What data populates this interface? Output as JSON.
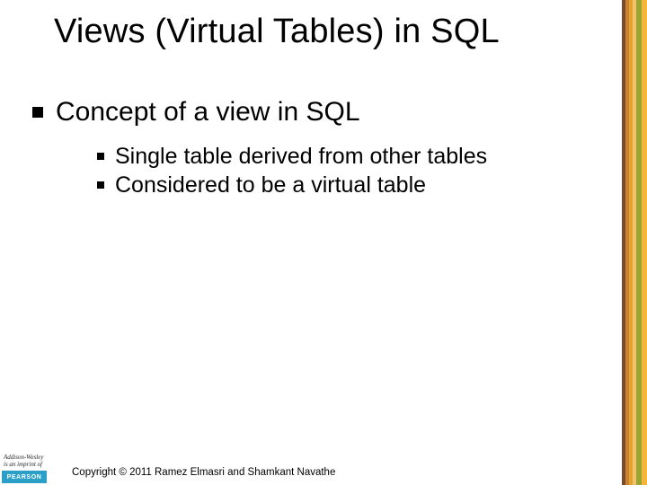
{
  "title": "Views (Virtual Tables) in SQL",
  "level1": {
    "item1": "Concept of a view in SQL"
  },
  "level2": {
    "item1": "Single table derived from other tables",
    "item2": "Considered to be a virtual table"
  },
  "footer": {
    "publisher_line1": "Addison-Wesley",
    "publisher_line2": "is an imprint of",
    "brand": "PEARSON",
    "copyright": "Copyright © 2011 Ramez Elmasri and Shamkant Navathe"
  }
}
